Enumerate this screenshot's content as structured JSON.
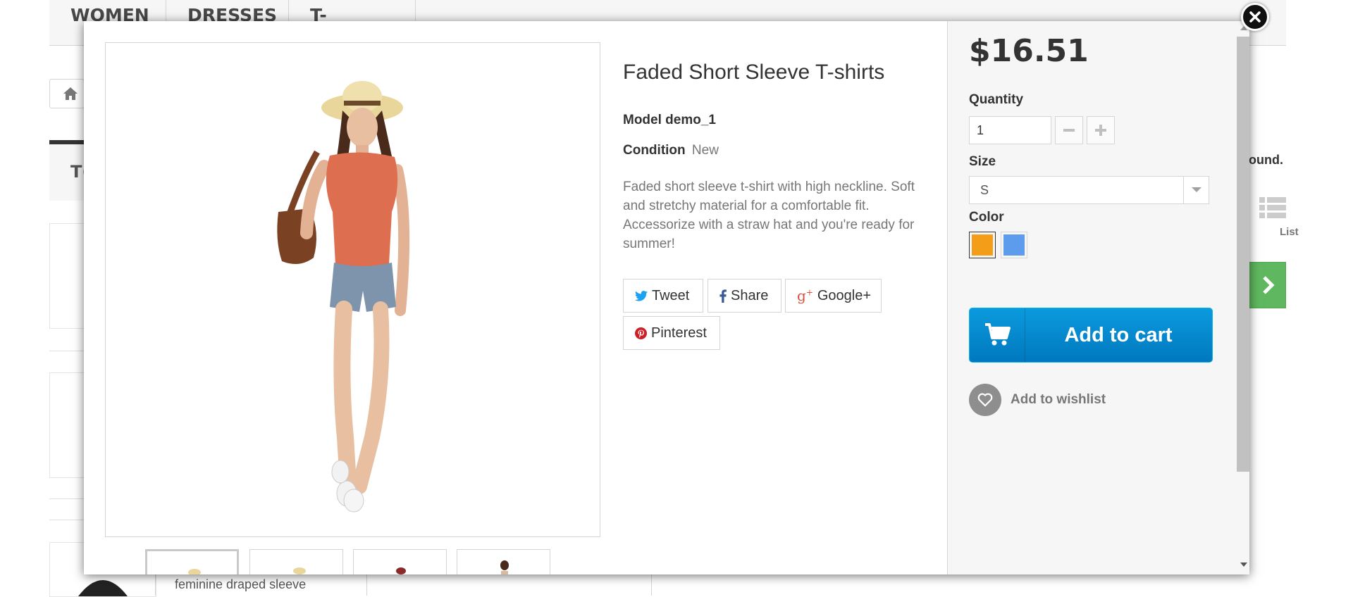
{
  "background": {
    "menu": [
      "WOMEN",
      "DRESSES",
      "T-SHIRTS"
    ],
    "category_partial": "T(",
    "found_partial": "ound.",
    "view_list_label": "List",
    "bottom_text": "feminine draped sleeve"
  },
  "product": {
    "title": "Faded Short Sleeve T-shirts",
    "model_label": "Model demo_1",
    "condition_label": "Condition",
    "condition_value": "New",
    "description": "Faded short sleeve t-shirt with high neckline. Soft and stretchy material for a comfortable fit. Accessorize with a straw hat and you're ready for summer!",
    "share": [
      {
        "label": "Tweet",
        "icon": "twitter-icon",
        "color": "#1da1f2"
      },
      {
        "label": "Share",
        "icon": "facebook-icon",
        "color": "#3b5998"
      },
      {
        "label": "Google+",
        "icon": "google-plus-icon",
        "color": "#dd4b39"
      },
      {
        "label": "Pinterest",
        "icon": "pinterest-icon",
        "color": "#cb2027"
      }
    ]
  },
  "buy_box": {
    "price": "$16.51",
    "quantity_label": "Quantity",
    "quantity_value": "1",
    "size_label": "Size",
    "size_value": "S",
    "color_label": "Color",
    "colors": [
      "#f39d19",
      "#5d9cec"
    ],
    "add_to_cart": "Add to cart",
    "add_to_wishlist": "Add to wishlist"
  },
  "colors": {
    "cart_blue": "#0b8ed3",
    "panel_bg": "#f6f6f6",
    "green_button": "#5fb85f"
  }
}
